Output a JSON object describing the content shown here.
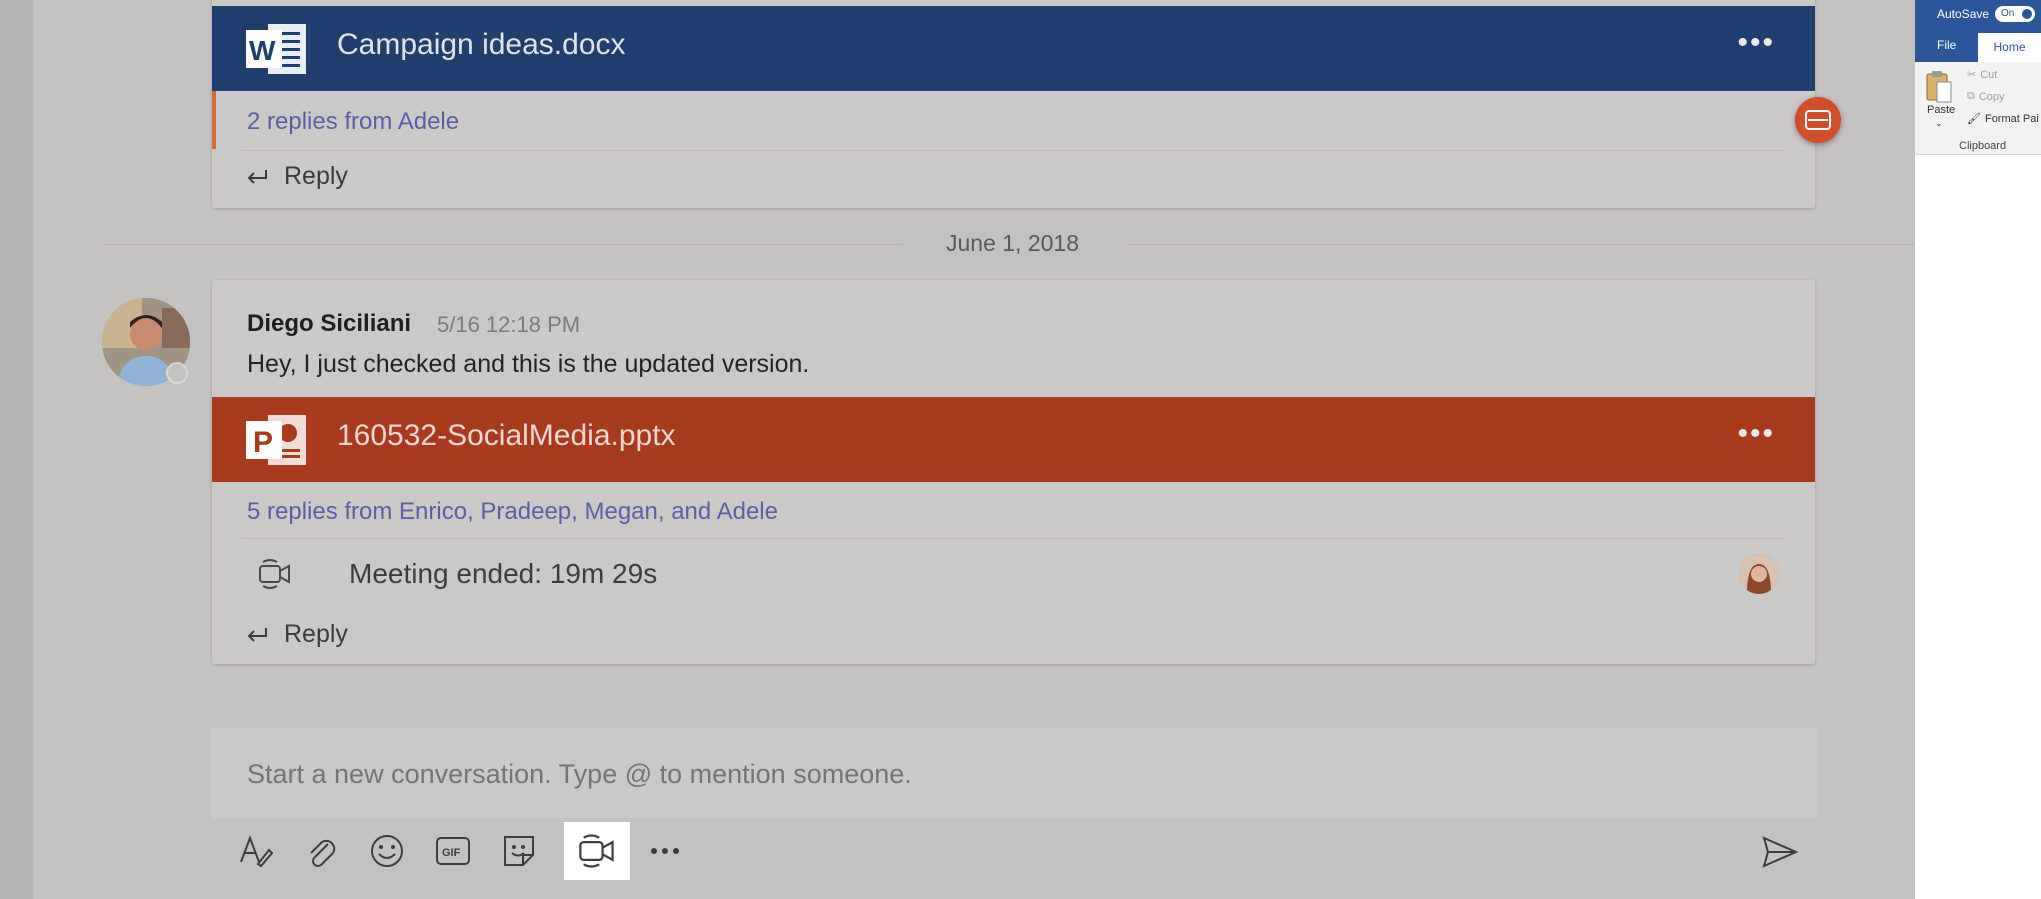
{
  "thread1": {
    "file_name": "Campaign ideas.docx",
    "replies_link": "2 replies from Adele",
    "reply_label": "Reply"
  },
  "date_separator": "June 1, 2018",
  "thread2": {
    "sender": "Diego Siciliani",
    "time": "5/16 12:18 PM",
    "message": "Hey, I just checked and this is the updated version.",
    "file_name": "160532-SocialMedia.pptx",
    "replies_link": "5 replies from Enrico, Pradeep, Megan, and Adele",
    "meeting_text": "Meeting ended: 19m 29s",
    "reply_label": "Reply"
  },
  "compose": {
    "placeholder": "Start a new conversation. Type @ to mention someone."
  },
  "toolbar": {
    "icons": [
      "format-icon",
      "attach-icon",
      "emoji-icon",
      "gif-icon",
      "sticker-icon",
      "meet-now-icon",
      "more-icon",
      "send-icon"
    ],
    "gif_label": "GIF",
    "active": "meet-now-icon"
  },
  "word_ribbon": {
    "autosave_label": "AutoSave",
    "autosave_state": "On",
    "tabs": [
      "File",
      "Home"
    ],
    "active_tab": "Home",
    "paste_label": "Paste",
    "cut_label": "Cut",
    "copy_label": "Copy",
    "format_painter_label": "Format Pai",
    "group_label": "Clipboard"
  },
  "colors": {
    "word_blue": "#1f3f6e",
    "ppt_orange": "#a83a1d",
    "link": "#5b5fa8",
    "ribbon_blue": "#2b579a"
  }
}
